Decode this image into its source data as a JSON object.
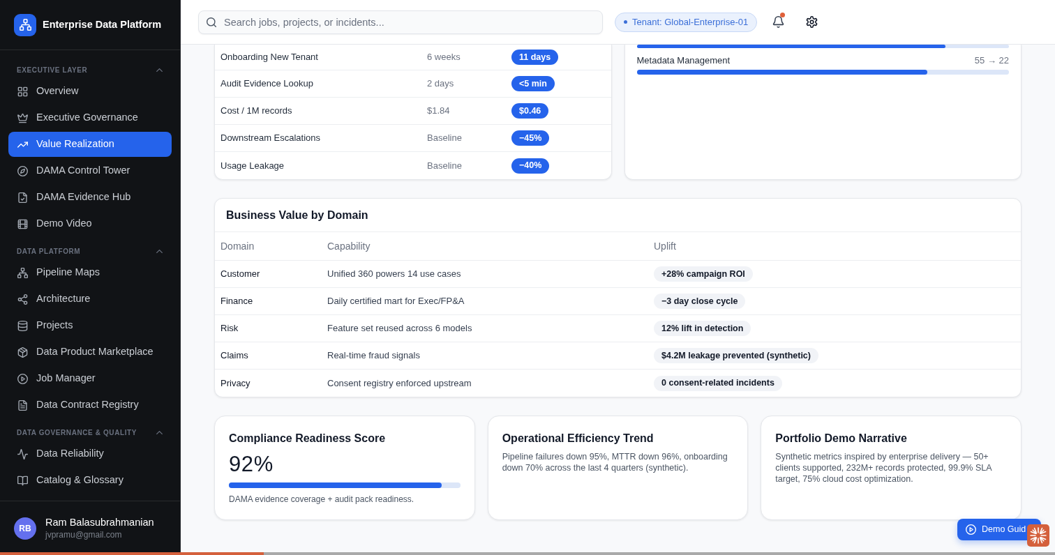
{
  "sidebar": {
    "brand": "Enterprise Data Platform",
    "sections": [
      {
        "title": "EXECUTIVE LAYER",
        "expanded": true,
        "items": [
          {
            "label": "Overview",
            "selected": false
          },
          {
            "label": "Executive Governance",
            "selected": false
          },
          {
            "label": "Value Realization",
            "selected": true
          },
          {
            "label": "DAMA Control Tower",
            "selected": false
          },
          {
            "label": "DAMA Evidence Hub",
            "selected": false
          },
          {
            "label": "Demo Video",
            "selected": false
          }
        ]
      },
      {
        "title": "DATA PLATFORM",
        "expanded": true,
        "items": [
          {
            "label": "Pipeline Maps",
            "selected": false
          },
          {
            "label": "Architecture",
            "selected": false
          },
          {
            "label": "Projects",
            "selected": false
          },
          {
            "label": "Data Product Marketplace",
            "selected": false
          },
          {
            "label": "Job Manager",
            "selected": false
          },
          {
            "label": "Data Contract Registry",
            "selected": false
          }
        ]
      },
      {
        "title": "DATA GOVERNANCE & QUALITY",
        "expanded": true,
        "items": [
          {
            "label": "Data Reliability",
            "selected": false
          },
          {
            "label": "Catalog & Glossary",
            "selected": false
          }
        ]
      }
    ],
    "user": {
      "initials": "RB",
      "name": "Ram Balasubrahmanian",
      "email": "jvpramu@gmail.com"
    }
  },
  "top_bar": {
    "search": {
      "placeholder": "Search jobs, projects, or incidents..."
    },
    "tenant": "Tenant: Global-Enterprise-01",
    "notifications": {
      "unread": true
    }
  },
  "comparison_table": {
    "rows": [
      [
        "Onboarding New Tenant",
        "6 weeks",
        "11 days"
      ],
      [
        "Audit Evidence Lookup",
        "2 days",
        "<5 min"
      ],
      [
        "Cost / 1M records",
        "$1.84",
        "$0.46"
      ],
      [
        "Downstream Escalations",
        "Baseline",
        "−45%"
      ],
      [
        "Usage Leakage",
        "Baseline",
        "−40%"
      ]
    ]
  },
  "progress_list": [
    {
      "level": 0.83
    },
    {
      "label": "Metadata Management",
      "reading": "55 → 22",
      "level": 0.78
    }
  ],
  "business_value": {
    "title": "Business Value by Domain",
    "columns": [
      "Domain",
      "Capability",
      "Uplift"
    ],
    "rows": [
      [
        "Customer",
        "Unified 360 powers 14 use cases",
        "+28% campaign ROI"
      ],
      [
        "Finance",
        "Daily certified mart for Exec/FP&A",
        "−3 day close cycle"
      ],
      [
        "Risk",
        "Feature set reused across 6 models",
        "12% lift in detection"
      ],
      [
        "Claims",
        "Real-time fraud signals",
        "$4.2M leakage prevented (synthetic)"
      ],
      [
        "Privacy",
        "Consent registry enforced upstream",
        "0 consent-related incidents"
      ]
    ]
  },
  "summary_cards": [
    {
      "kind": "score",
      "title": "Compliance Readiness Score",
      "value": "92%",
      "level": 0.92,
      "caption": "DAMA evidence coverage + audit pack readiness."
    },
    {
      "kind": "text",
      "title": "Operational Efficiency Trend",
      "body": "Pipeline failures down 95%, MTTR down 96%, onboarding down 70% across the last 4 quarters (synthetic)."
    },
    {
      "kind": "text",
      "title": "Portfolio Demo Narrative",
      "body": "Synthetic metrics inspired by enterprise delivery — 50+ clients supported, 232M+ records protected, 99.9% SLA target, 75% cloud cost optimization."
    }
  ],
  "demo_guide_button": {
    "label": "Demo Guid"
  },
  "playback_bar": {
    "level": 0.25
  }
}
